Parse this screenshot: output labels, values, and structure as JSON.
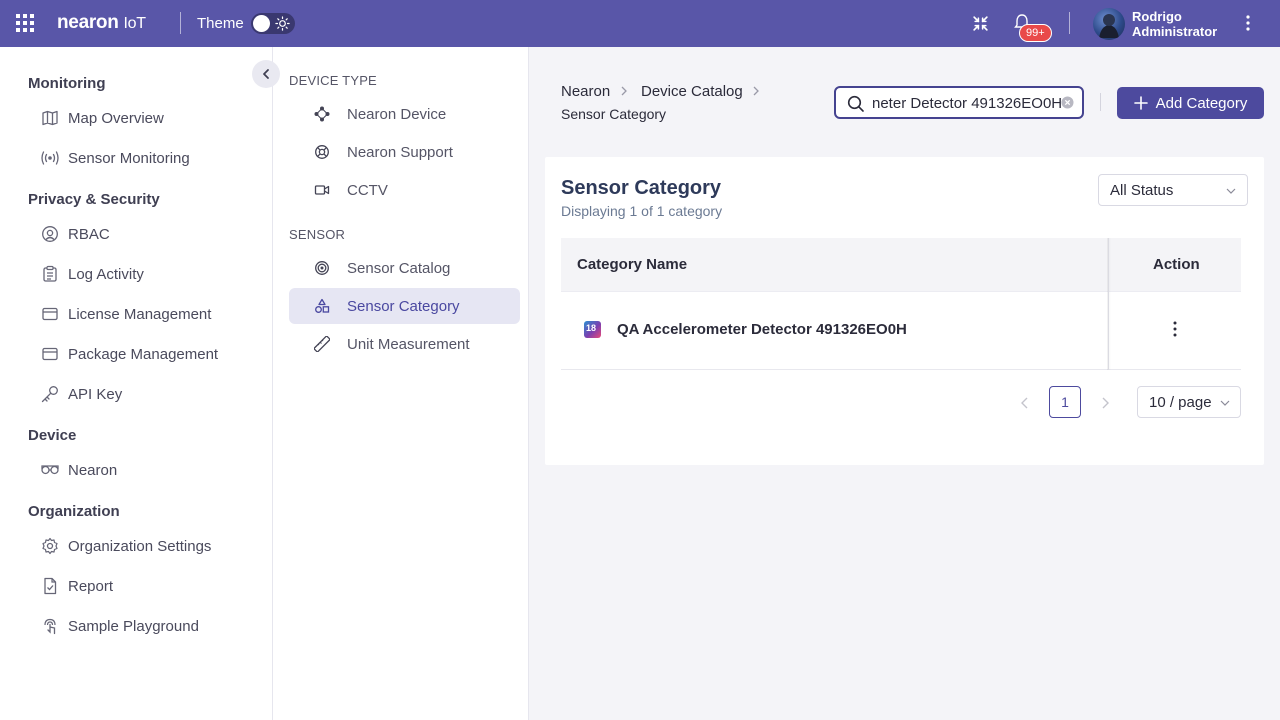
{
  "topbar": {
    "logo_main": "nearon",
    "logo_sub": "IoT",
    "theme_label": "Theme",
    "notification_count": "99+",
    "user_name": "Rodrigo",
    "user_role": "Administrator",
    "brand_color": "#5956a8"
  },
  "sidebar": {
    "sections": [
      {
        "title": "Monitoring",
        "items": [
          {
            "label": "Map Overview",
            "icon": "map-icon"
          },
          {
            "label": "Sensor Monitoring",
            "icon": "broadcast-icon"
          }
        ]
      },
      {
        "title": "Privacy & Security",
        "items": [
          {
            "label": "RBAC",
            "icon": "user-circle-icon"
          },
          {
            "label": "Log Activity",
            "icon": "clipboard-icon"
          },
          {
            "label": "License Management",
            "icon": "card-icon"
          },
          {
            "label": "Package Management",
            "icon": "card-icon"
          },
          {
            "label": "API Key",
            "icon": "key-icon"
          }
        ]
      },
      {
        "title": "Device",
        "items": [
          {
            "label": "Nearon",
            "icon": "glasses-icon"
          }
        ]
      },
      {
        "title": "Organization",
        "items": [
          {
            "label": "Organization Settings",
            "icon": "gear-icon"
          },
          {
            "label": "Report",
            "icon": "document-check-icon"
          },
          {
            "label": "Sample Playground",
            "icon": "touch-icon"
          }
        ]
      }
    ]
  },
  "subnav": {
    "device_type_title": "DEVICE TYPE",
    "device_items": [
      {
        "label": "Nearon Device",
        "icon": "diamond-nodes-icon"
      },
      {
        "label": "Nearon Support",
        "icon": "lifebuoy-icon"
      },
      {
        "label": "CCTV",
        "icon": "video-camera-icon"
      }
    ],
    "sensor_title": "SENSOR",
    "sensor_items": [
      {
        "label": "Sensor Catalog",
        "icon": "target-icon",
        "active": false
      },
      {
        "label": "Sensor Category",
        "icon": "shapes-icon",
        "active": true
      },
      {
        "label": "Unit Measurement",
        "icon": "ruler-icon",
        "active": false
      }
    ]
  },
  "breadcrumb": {
    "items": [
      "Nearon",
      "Device Catalog",
      "Sensor Category"
    ]
  },
  "search": {
    "value": "QA Accelerometer Detector 491326EO0H",
    "visible_text": "neter Detector 491326EO0H"
  },
  "actions": {
    "add_label": "Add Category"
  },
  "card": {
    "title": "Sensor Category",
    "subtitle": "Displaying 1 of 1 category",
    "status_filter": "All Status"
  },
  "table": {
    "headers": [
      "Category Name",
      "Action"
    ],
    "rows": [
      {
        "name": "QA Accelerometer Detector 491326EO0H",
        "icon_text": "18"
      }
    ]
  },
  "pagination": {
    "current_page": "1",
    "page_size": "10 / page"
  }
}
